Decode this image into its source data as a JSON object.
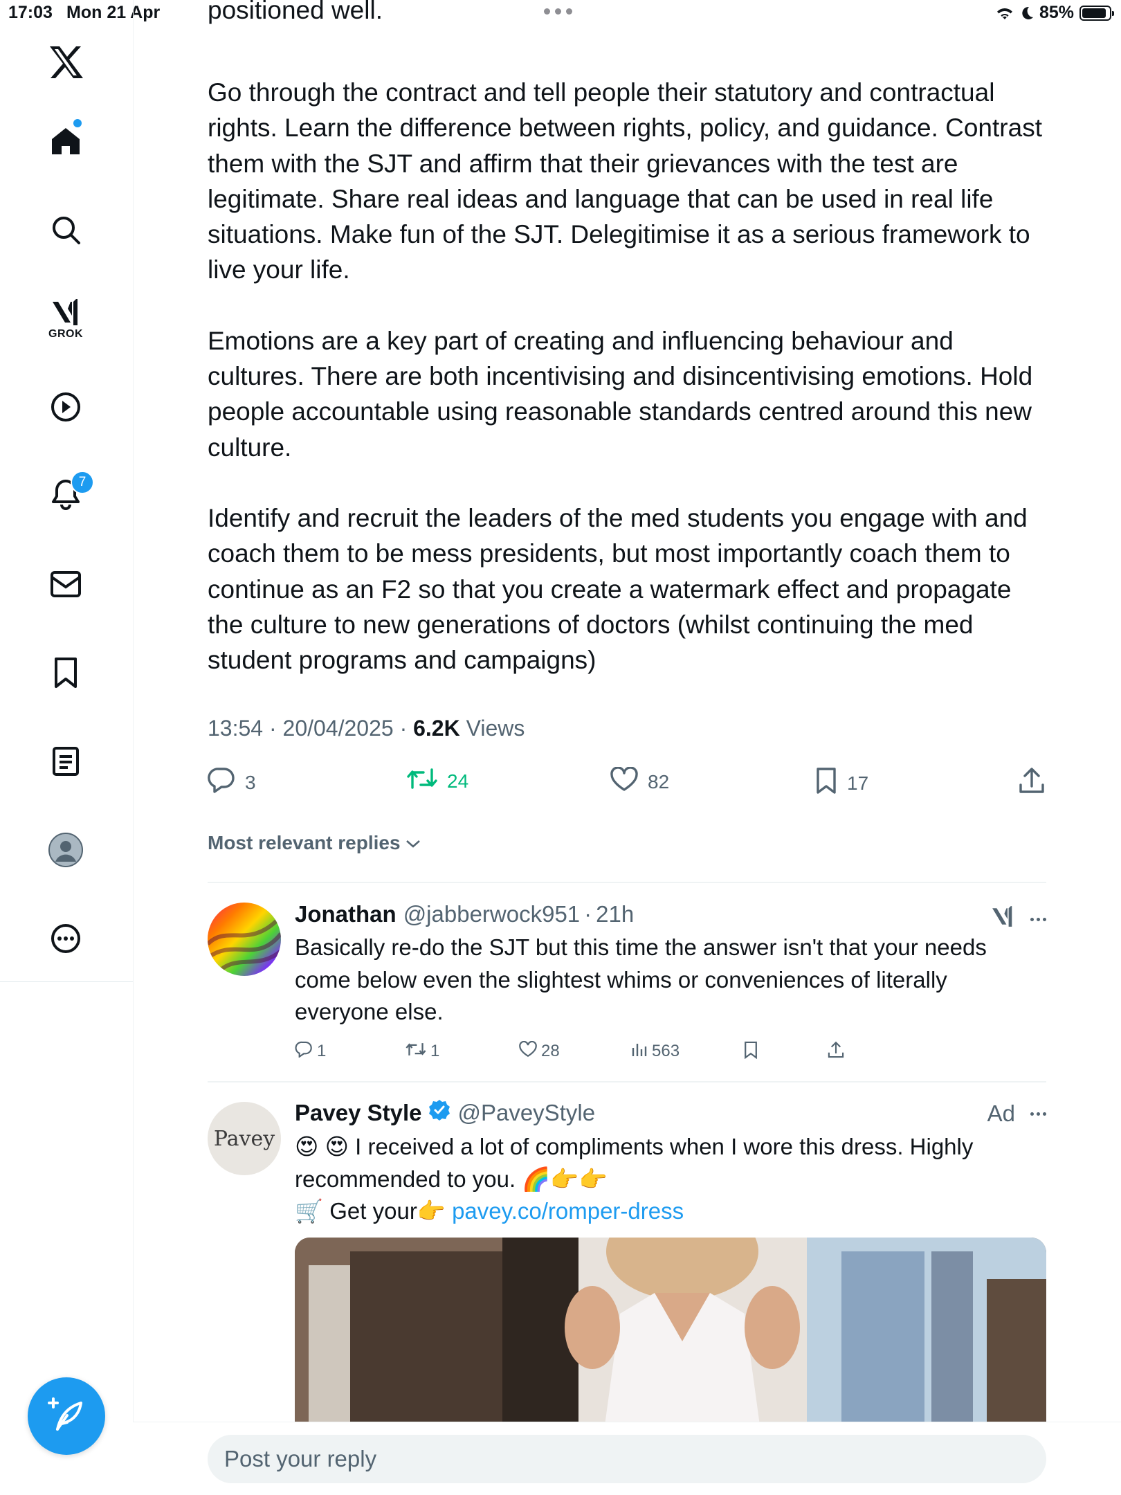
{
  "status_bar": {
    "time": "17:03",
    "date": "Mon 21 Apr",
    "battery": "85%"
  },
  "sidebar": {
    "grok_label": "GROK",
    "notifications_count": "7",
    "items": [
      "x-logo-icon",
      "home-icon",
      "search-icon",
      "grok-icon",
      "video-icon",
      "notifications-icon",
      "messages-icon",
      "bookmarks-icon",
      "lists-icon",
      "profile-icon",
      "more-icon"
    ]
  },
  "post": {
    "cut_line": "positioned well.",
    "paragraphs": [
      "Go through the contract and tell people their statutory and contractual rights. Learn the difference between rights, policy, and guidance. Contrast them with the SJT and affirm that their grievances with the test are legitimate. Share real ideas and language that can be used in real life situations. Make fun of the SJT. Delegitimise it as a serious framework to live your life.",
      "Emotions are a key part of creating and influencing behaviour and cultures. There are both incentivising and disincentivising emotions. Hold people accountable using reasonable standards centred around this new culture.",
      "Identify and recruit the leaders of the med students you engage with and coach them to be mess presidents, but most importantly coach them to continue as an F2 so that you create a watermark effect and propagate the culture to new generations of doctors (whilst continuing the med student programs and campaigns)"
    ],
    "timestamp": "13:54 · 20/04/2025 · ",
    "views_count": "6.2K",
    "views_label": " Views",
    "replies": "3",
    "reposts": "24",
    "likes": "82",
    "bookmarks": "17"
  },
  "sort_label": "Most relevant replies",
  "replies": [
    {
      "name": "Jonathan",
      "handle": "@jabberwock951",
      "sep": "·",
      "time": "21h",
      "text": "Basically re-do the SJT but this time the answer isn't that your needs come below even the slightest whims or conveniences of literally everyone else.",
      "replies": "1",
      "reposts": "1",
      "likes": "28",
      "views": "563"
    },
    {
      "name": "Pavey Style",
      "handle": "@PaveyStyle",
      "ad_label": "Ad",
      "avatar_text": "Pavey",
      "line1_emoji": "😍 😍",
      "line1": " I received a lot of compliments when I wore this dress. Highly recommended to you. ",
      "line1_emoji_end": "🌈👉👉",
      "line2_prefix": "🛒 Get your👉 ",
      "link": "pavey.co/romper-dress"
    }
  ],
  "reply_box": {
    "placeholder": "Post your reply"
  },
  "colors": {
    "accent": "#1d9bf0",
    "repost_green": "#00ba7c",
    "secondary_text": "#536471"
  }
}
